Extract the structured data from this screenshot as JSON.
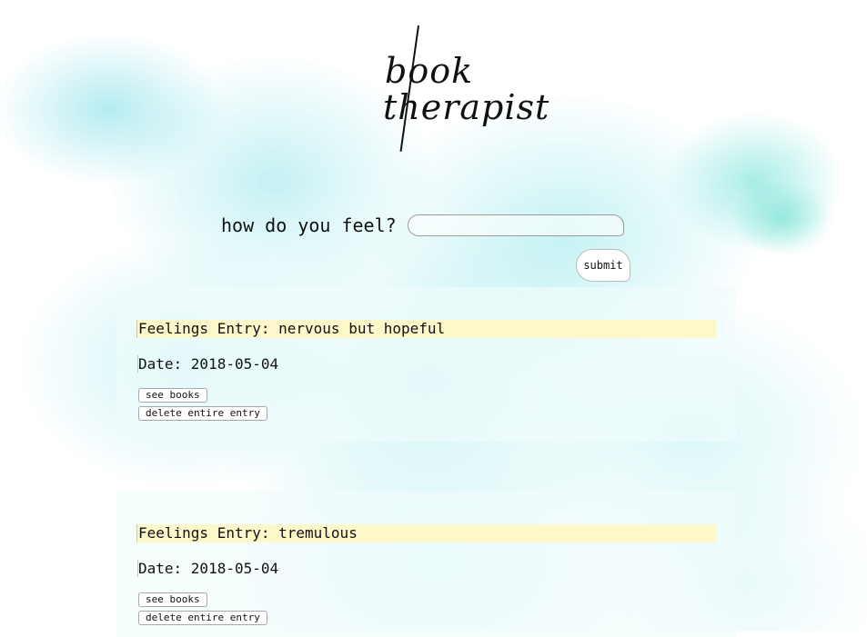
{
  "logo": {
    "line1": "book",
    "line2": "therapist"
  },
  "search": {
    "label": "how do you feel?",
    "value": "",
    "placeholder": "",
    "submit_label": "submit"
  },
  "entries": [
    {
      "title_prefix": "Feelings Entry: ",
      "feeling": "nervous but hopeful",
      "date_prefix": "Date: ",
      "date": "2018-05-04",
      "see_books_label": "see books",
      "delete_label": "delete entire entry"
    },
    {
      "title_prefix": "Feelings Entry: ",
      "feeling": "tremulous",
      "date_prefix": "Date: ",
      "date": "2018-05-04",
      "see_books_label": "see books",
      "delete_label": "delete entire entry"
    }
  ],
  "colors": {
    "watercolor": "#96e8ec",
    "title_highlight": "#fdf8c9",
    "panel": "#f0fcfc"
  }
}
